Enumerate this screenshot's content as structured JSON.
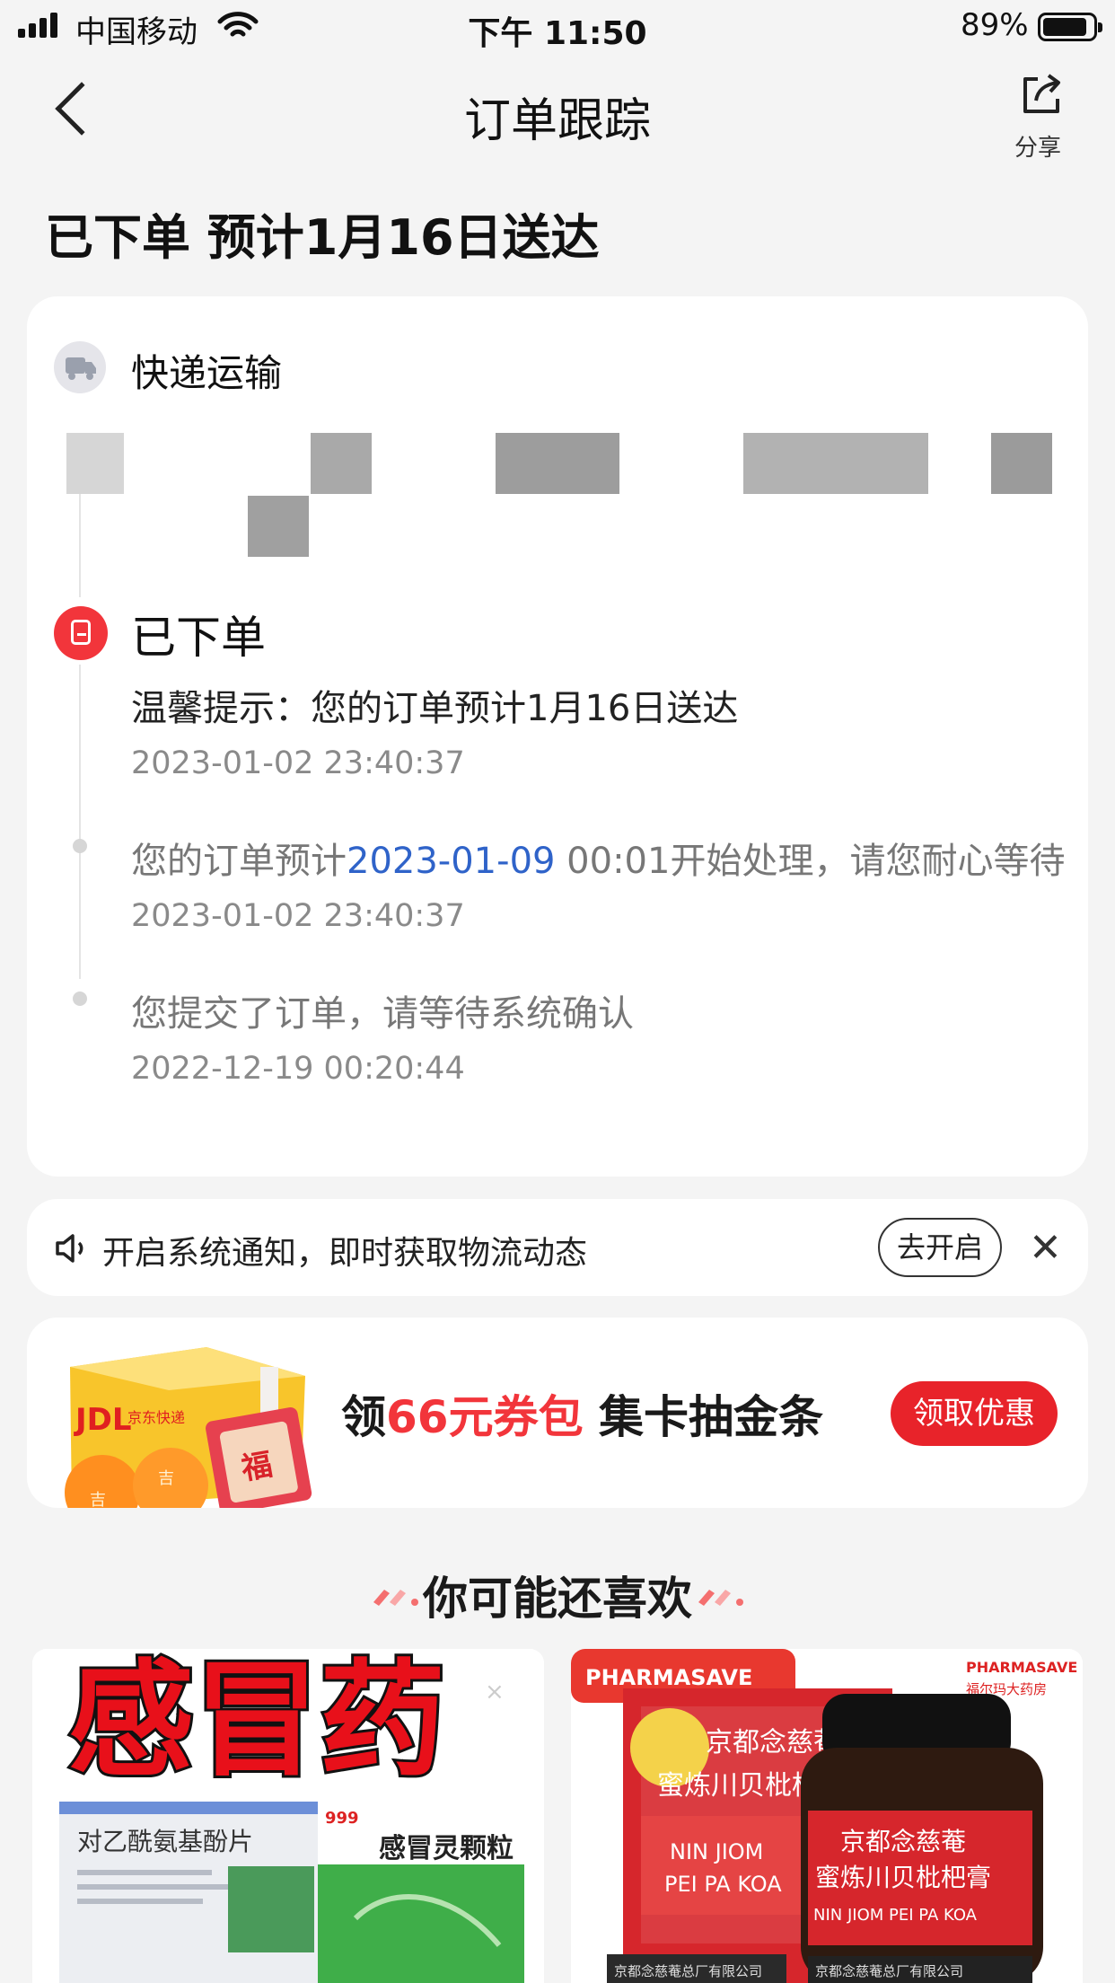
{
  "status_bar": {
    "carrier": "中国移动",
    "time": "下午 11:50",
    "battery": "89%",
    "battery_level": 0.89
  },
  "nav": {
    "title": "订单跟踪",
    "share_label": "分享"
  },
  "headline": "已下单 预计1月16日送达",
  "tracking": {
    "section_title": "快递运输",
    "status_title": "已下单",
    "events": [
      {
        "text": "温馨提示：您的订单预计1月16日送达",
        "time": "2023-01-02 23:40:37"
      },
      {
        "text_prefix": "您的订单预计",
        "text_date": "2023-01-09",
        "text_suffix": " 00:01开始处理，请您耐心等待",
        "time": "2023-01-02 23:40:37"
      },
      {
        "text": "您提交了订单，请等待系统确认",
        "time": "2022-12-19 00:20:44"
      }
    ]
  },
  "notification": {
    "text": "开启系统通知，即时获取物流动态",
    "button": "去开启"
  },
  "promo": {
    "prefix": "领",
    "highlight": "66元券包",
    "suffix": " 集卡抽金条",
    "button": "领取优惠",
    "image": {
      "logo": "JDL",
      "logo_sub": "京东快递",
      "card_char": "福",
      "orange_char": "吉"
    }
  },
  "recommend": {
    "title": "你可能还喜欢",
    "products": [
      {
        "headline": "感冒药",
        "box1": "对乙酰氨基酚片",
        "box2_brand": "999",
        "box2": "感冒灵颗粒"
      },
      {
        "badge": "PHARMASAVE",
        "badge_right": "PHARMASAVE",
        "badge_right_sub": "福尔玛大药房",
        "box_title_1": "京都念慈菴",
        "box_title_2": "蜜炼川贝枇杷膏",
        "box_en_1": "NIN JIOM",
        "box_en_2": "PEI PA KOA",
        "bottle_title_1": "京都念慈菴",
        "bottle_title_2": "蜜炼川贝枇杷膏",
        "bottle_en": "NIN JIOM PEI PA KOA",
        "maker": "京都念慈菴总厂有限公司"
      }
    ]
  },
  "colors": {
    "accent": "#e8232a",
    "link": "#2f63c9",
    "background": "#f4f4f4"
  }
}
